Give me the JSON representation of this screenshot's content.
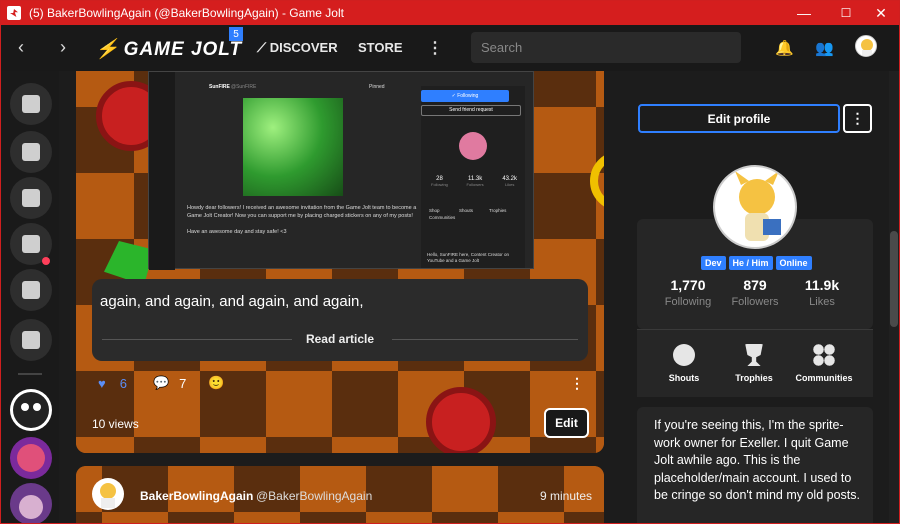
{
  "window": {
    "title": "(5) BakerBowlingAgain (@BakerBowlingAgain) - Game Jolt",
    "minimize": "—",
    "maximize": "☐",
    "close": "✕"
  },
  "topbar": {
    "back": "‹",
    "forward": "›",
    "brand": "GAME JOLT",
    "brand_badge": "5",
    "discover": "DISCOVER",
    "store": "STORE",
    "more": "⋮",
    "search_placeholder": "Search"
  },
  "post1": {
    "excerpt": "again, and again, and again, and again,",
    "read_article": "Read article",
    "likes": "6",
    "comments": "7",
    "more": "⋮",
    "views": "10 views",
    "edit": "Edit",
    "screenshot": {
      "username": "SunFIRE",
      "handle": "@SunFIRE",
      "pinned": "Pinned",
      "following_btn": "✓ Following",
      "friend_btn": "Send friend request",
      "body": "Howdy dear followers! I received an awesome invitation from the Game Jolt team to become a Game Jolt Creator! Now you can support me by placing charged stickers on any of my posts!",
      "body2": "Have an awesome day and stay safe! <3",
      "stats": [
        {
          "n": "28",
          "l": "Following"
        },
        {
          "n": "11.3k",
          "l": "Followers"
        },
        {
          "n": "43.2k",
          "l": "Likes"
        }
      ],
      "tabs": [
        "Shop",
        "Shouts",
        "Trophies",
        "Communities"
      ],
      "bio": "Hello, SunFIRE here, Content Creator on YouTube and a Game Jolt"
    }
  },
  "post2": {
    "name": "BakerBowlingAgain",
    "handle": "@BakerBowlingAgain",
    "time": "9 minutes"
  },
  "profile": {
    "edit_profile": "Edit profile",
    "menu": "⋮",
    "tags": [
      "Dev",
      "He / Him",
      "Online"
    ],
    "stats": [
      {
        "n": "1,770",
        "l": "Following"
      },
      {
        "n": "879",
        "l": "Followers"
      },
      {
        "n": "11.9k",
        "l": "Likes"
      }
    ],
    "tabs": [
      "Shouts",
      "Trophies",
      "Communities"
    ],
    "bio": "If you're seeing this, I'm the sprite-work owner for Exeller. I quit Game Jolt awhile ago. This is the placeholder/main account. I used to be cringe so don't mind my old posts."
  },
  "colors": {
    "accent": "#2f7fff",
    "titlebar": "#d51e1e",
    "notify": "#ff3f5a"
  }
}
